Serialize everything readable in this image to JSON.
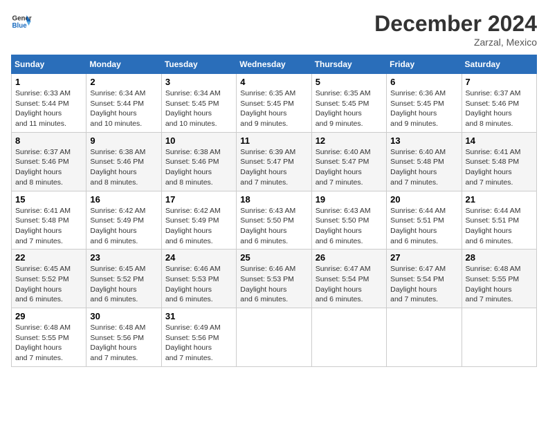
{
  "header": {
    "logo_line1": "General",
    "logo_line2": "Blue",
    "month_title": "December 2024",
    "location": "Zarzal, Mexico"
  },
  "weekdays": [
    "Sunday",
    "Monday",
    "Tuesday",
    "Wednesday",
    "Thursday",
    "Friday",
    "Saturday"
  ],
  "weeks": [
    [
      {
        "day": "1",
        "sunrise": "6:33 AM",
        "sunset": "5:44 PM",
        "daylight": "11 hours and 11 minutes."
      },
      {
        "day": "2",
        "sunrise": "6:34 AM",
        "sunset": "5:44 PM",
        "daylight": "11 hours and 10 minutes."
      },
      {
        "day": "3",
        "sunrise": "6:34 AM",
        "sunset": "5:45 PM",
        "daylight": "11 hours and 10 minutes."
      },
      {
        "day": "4",
        "sunrise": "6:35 AM",
        "sunset": "5:45 PM",
        "daylight": "11 hours and 9 minutes."
      },
      {
        "day": "5",
        "sunrise": "6:35 AM",
        "sunset": "5:45 PM",
        "daylight": "11 hours and 9 minutes."
      },
      {
        "day": "6",
        "sunrise": "6:36 AM",
        "sunset": "5:45 PM",
        "daylight": "11 hours and 9 minutes."
      },
      {
        "day": "7",
        "sunrise": "6:37 AM",
        "sunset": "5:46 PM",
        "daylight": "11 hours and 8 minutes."
      }
    ],
    [
      {
        "day": "8",
        "sunrise": "6:37 AM",
        "sunset": "5:46 PM",
        "daylight": "11 hours and 8 minutes."
      },
      {
        "day": "9",
        "sunrise": "6:38 AM",
        "sunset": "5:46 PM",
        "daylight": "11 hours and 8 minutes."
      },
      {
        "day": "10",
        "sunrise": "6:38 AM",
        "sunset": "5:46 PM",
        "daylight": "11 hours and 8 minutes."
      },
      {
        "day": "11",
        "sunrise": "6:39 AM",
        "sunset": "5:47 PM",
        "daylight": "11 hours and 7 minutes."
      },
      {
        "day": "12",
        "sunrise": "6:40 AM",
        "sunset": "5:47 PM",
        "daylight": "11 hours and 7 minutes."
      },
      {
        "day": "13",
        "sunrise": "6:40 AM",
        "sunset": "5:48 PM",
        "daylight": "11 hours and 7 minutes."
      },
      {
        "day": "14",
        "sunrise": "6:41 AM",
        "sunset": "5:48 PM",
        "daylight": "11 hours and 7 minutes."
      }
    ],
    [
      {
        "day": "15",
        "sunrise": "6:41 AM",
        "sunset": "5:48 PM",
        "daylight": "11 hours and 7 minutes."
      },
      {
        "day": "16",
        "sunrise": "6:42 AM",
        "sunset": "5:49 PM",
        "daylight": "11 hours and 6 minutes."
      },
      {
        "day": "17",
        "sunrise": "6:42 AM",
        "sunset": "5:49 PM",
        "daylight": "11 hours and 6 minutes."
      },
      {
        "day": "18",
        "sunrise": "6:43 AM",
        "sunset": "5:50 PM",
        "daylight": "11 hours and 6 minutes."
      },
      {
        "day": "19",
        "sunrise": "6:43 AM",
        "sunset": "5:50 PM",
        "daylight": "11 hours and 6 minutes."
      },
      {
        "day": "20",
        "sunrise": "6:44 AM",
        "sunset": "5:51 PM",
        "daylight": "11 hours and 6 minutes."
      },
      {
        "day": "21",
        "sunrise": "6:44 AM",
        "sunset": "5:51 PM",
        "daylight": "11 hours and 6 minutes."
      }
    ],
    [
      {
        "day": "22",
        "sunrise": "6:45 AM",
        "sunset": "5:52 PM",
        "daylight": "11 hours and 6 minutes."
      },
      {
        "day": "23",
        "sunrise": "6:45 AM",
        "sunset": "5:52 PM",
        "daylight": "11 hours and 6 minutes."
      },
      {
        "day": "24",
        "sunrise": "6:46 AM",
        "sunset": "5:53 PM",
        "daylight": "11 hours and 6 minutes."
      },
      {
        "day": "25",
        "sunrise": "6:46 AM",
        "sunset": "5:53 PM",
        "daylight": "11 hours and 6 minutes."
      },
      {
        "day": "26",
        "sunrise": "6:47 AM",
        "sunset": "5:54 PM",
        "daylight": "11 hours and 6 minutes."
      },
      {
        "day": "27",
        "sunrise": "6:47 AM",
        "sunset": "5:54 PM",
        "daylight": "11 hours and 7 minutes."
      },
      {
        "day": "28",
        "sunrise": "6:48 AM",
        "sunset": "5:55 PM",
        "daylight": "11 hours and 7 minutes."
      }
    ],
    [
      {
        "day": "29",
        "sunrise": "6:48 AM",
        "sunset": "5:55 PM",
        "daylight": "11 hours and 7 minutes."
      },
      {
        "day": "30",
        "sunrise": "6:48 AM",
        "sunset": "5:56 PM",
        "daylight": "11 hours and 7 minutes."
      },
      {
        "day": "31",
        "sunrise": "6:49 AM",
        "sunset": "5:56 PM",
        "daylight": "11 hours and 7 minutes."
      },
      null,
      null,
      null,
      null
    ]
  ],
  "labels": {
    "sunrise": "Sunrise:",
    "sunset": "Sunset:",
    "daylight": "Daylight hours"
  }
}
